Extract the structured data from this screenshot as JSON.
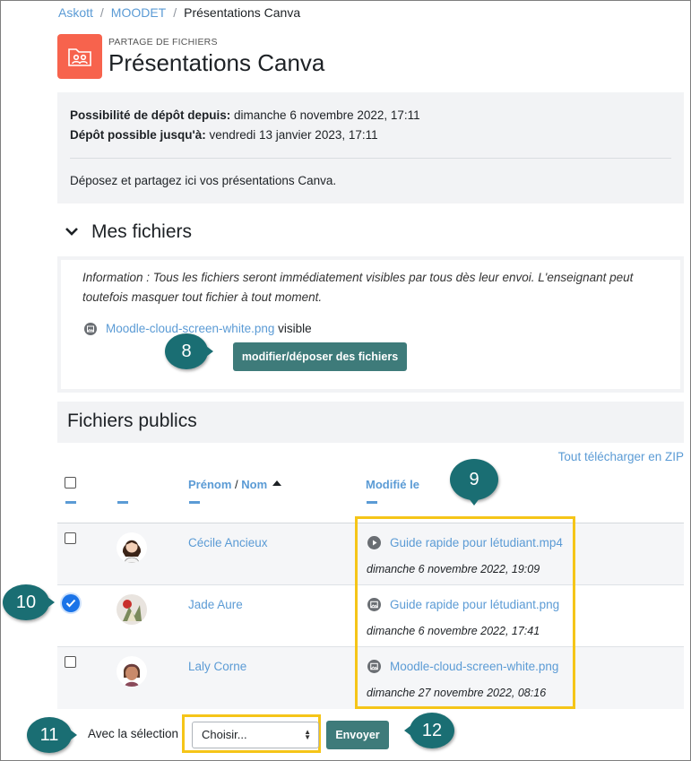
{
  "breadcrumb": [
    "Askott",
    "MOODET",
    "Présentations Canva"
  ],
  "header": {
    "kicker": "PARTAGE DE FICHIERS",
    "title": "Présentations Canva"
  },
  "dates": {
    "from_label": "Possibilité de dépôt depuis:",
    "from_value": " dimanche 6 novembre 2022, 17:11",
    "until_label": "Dépôt possible jusqu'à:",
    "until_value": " vendredi 13 janvier 2023, 17:11",
    "description": "Déposez et partagez ici vos présentations Canva."
  },
  "my_files": {
    "title": "Mes fichiers",
    "info": "Information : Tous les fichiers seront immédiatement visibles par tous dès leur envoi. L'enseignant peut toutefois masquer tout fichier à tout moment.",
    "file_name": "Moodle-cloud-screen-white.png",
    "file_status": "visible",
    "edit_button": "modifier/déposer des fichiers"
  },
  "public_files": {
    "title": "Fichiers publics",
    "download_all": "Tout télécharger en ZIP",
    "col_firstname": "Prénom",
    "col_sep": " / ",
    "col_lastname": "Nom",
    "col_modified": "Modifié le",
    "rows": [
      {
        "name": "Cécile Ancieux",
        "file": "Guide rapide pour létudiant.mp4",
        "file_icon": "play-icon",
        "date": "dimanche 6 novembre 2022, 19:09",
        "checked": false
      },
      {
        "name": "Jade Aure",
        "file": "Guide rapide pour létudiant.png",
        "file_icon": "image-icon",
        "date": "dimanche 6 novembre 2022, 17:41",
        "checked": true
      },
      {
        "name": "Laly Corne",
        "file": "Moodle-cloud-screen-white.png",
        "file_icon": "image-icon",
        "date": "dimanche 27 novembre 2022, 08:16",
        "checked": false
      }
    ]
  },
  "bulk": {
    "label": "Avec la sélection :",
    "select_value": "Choisir...",
    "send_button": "Envoyer"
  },
  "callouts": [
    "8",
    "9",
    "10",
    "11",
    "12"
  ],
  "colors": {
    "accent_teal": "#3e7b7a",
    "callout": "#1a6e73",
    "link": "#5b9bd5",
    "highlight": "#f5c518",
    "module_icon": "#f7634d"
  }
}
